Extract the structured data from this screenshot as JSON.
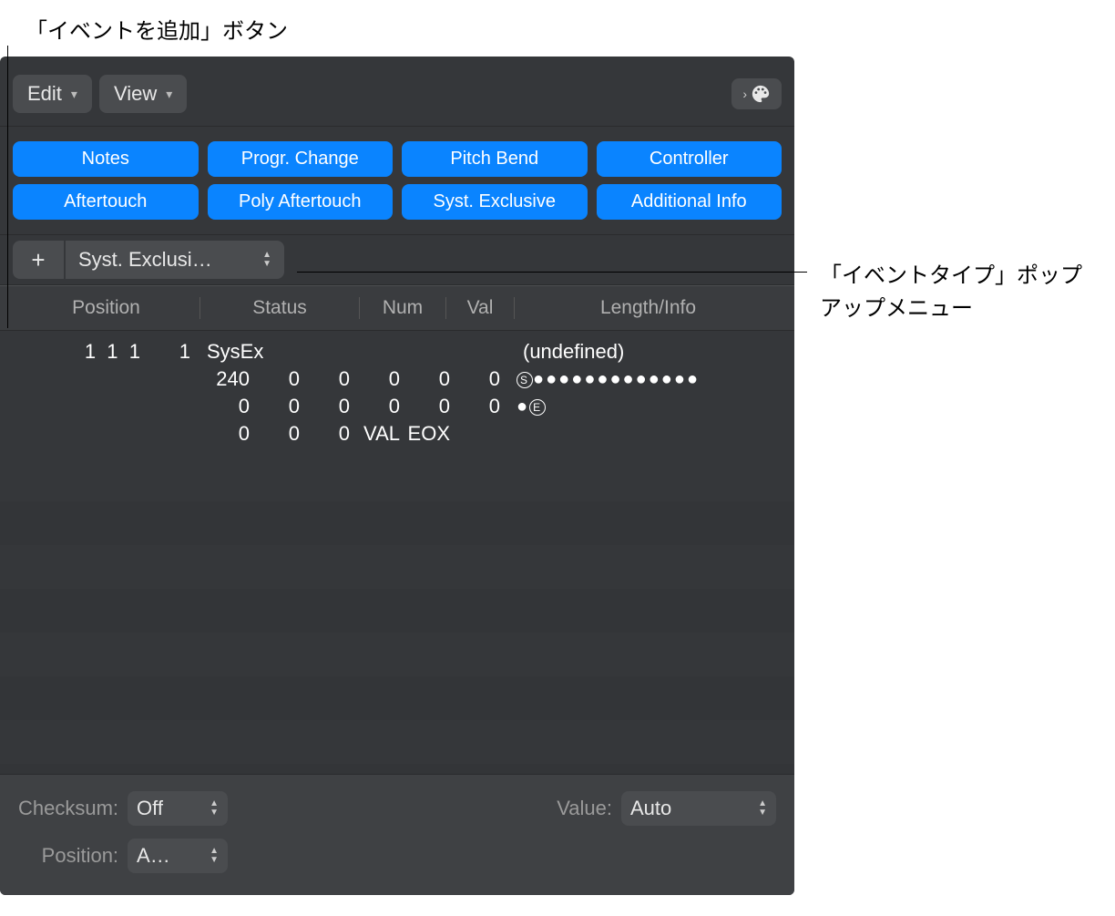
{
  "callouts": {
    "add_button": "「イベントを追加」ボタン",
    "event_type_popup_line1": "「イベントタイプ」ポップ",
    "event_type_popup_line2": "アップメニュー"
  },
  "toolbar": {
    "edit_menu": "Edit",
    "view_menu": "View"
  },
  "filters": {
    "notes": "Notes",
    "progr_change": "Progr. Change",
    "pitch_bend": "Pitch Bend",
    "controller": "Controller",
    "aftertouch": "Aftertouch",
    "poly_aftertouch": "Poly Aftertouch",
    "syst_exclusive": "Syst. Exclusive",
    "additional_info": "Additional Info"
  },
  "add_row": {
    "plus": "+",
    "event_type": "Syst. Exclusi…"
  },
  "columns": {
    "position": "Position",
    "status": "Status",
    "num": "Num",
    "val": "Val",
    "length_info": "Length/Info"
  },
  "event": {
    "position": "1  1  1       1",
    "status": "SysEx",
    "length_info": "(undefined)",
    "bytes_row1": [
      "240",
      "0",
      "0",
      "0",
      "0",
      "0"
    ],
    "bytes_row2": [
      "0",
      "0",
      "0",
      "0",
      "0",
      "0"
    ],
    "bytes_row3": [
      "0",
      "0",
      "0",
      "VAL",
      "EOX"
    ],
    "dots1": "●●●●●●●●●●●●●",
    "dot2": "●",
    "circled_s": "S",
    "circled_e": "E"
  },
  "footer": {
    "checksum_label": "Checksum:",
    "checksum_value": "Off",
    "value_label": "Value:",
    "value_value": "Auto",
    "position_label": "Position:",
    "position_value": "A…"
  }
}
